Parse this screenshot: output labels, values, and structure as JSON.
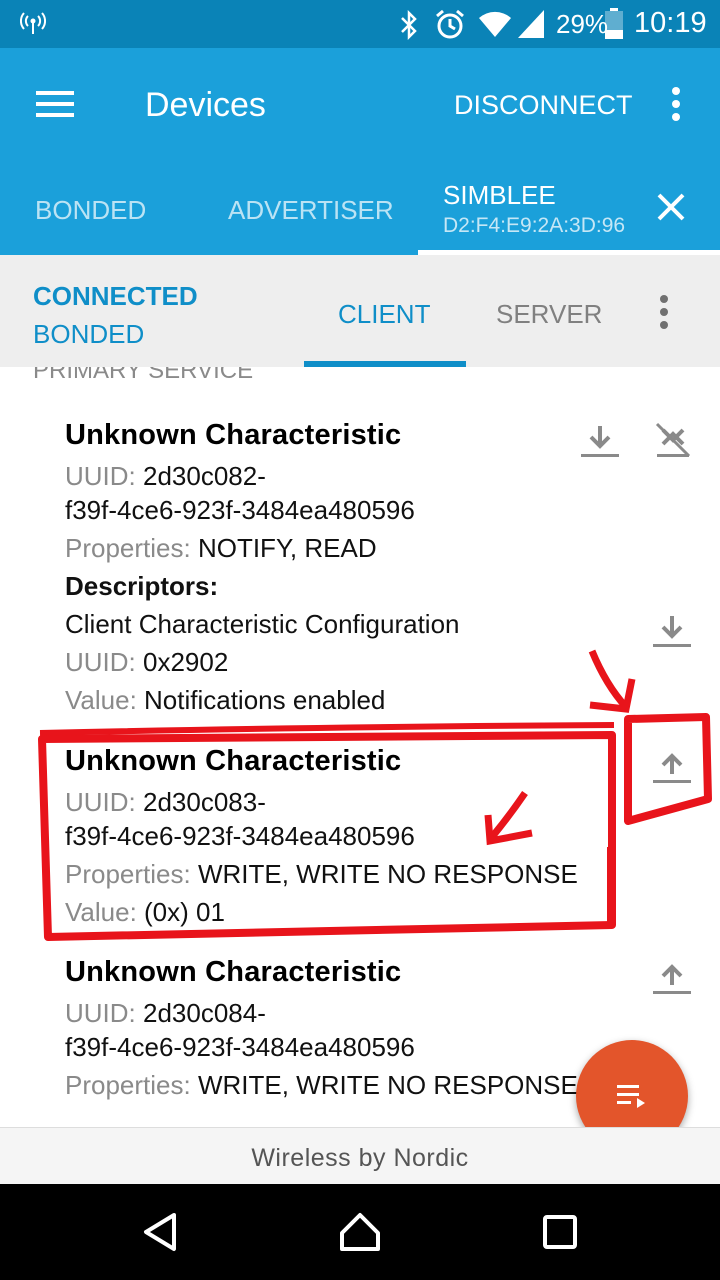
{
  "status_bar": {
    "battery": "29%",
    "time": "10:19"
  },
  "toolbar": {
    "title": "Devices",
    "disconnect_label": "DISCONNECT"
  },
  "device_tabs": [
    {
      "label": "BONDED"
    },
    {
      "label": "ADVERTISER"
    },
    {
      "label": "SIMBLEE",
      "sublabel": "D2:F4:E9:2A:3D:96",
      "selected": true
    }
  ],
  "connection": {
    "state": "CONNECTED",
    "bond": "BONDED"
  },
  "sub_tabs": [
    {
      "label": "CLIENT",
      "selected": true
    },
    {
      "label": "SERVER"
    }
  ],
  "section_header": "PRIMARY SERVICE",
  "labels": {
    "uuid": "UUID: ",
    "properties": "Properties: ",
    "value": "Value: ",
    "descriptors": "Descriptors:"
  },
  "characteristics": [
    {
      "name": "Unknown Characteristic",
      "uuid_line1": "2d30c082-",
      "uuid_line2": "f39f-4ce6-923f-3484ea480596",
      "properties": "NOTIFY, READ",
      "descriptor": {
        "name": "Client Characteristic Configuration",
        "uuid": "0x2902",
        "value": "Notifications enabled"
      }
    },
    {
      "name": "Unknown Characteristic",
      "uuid_line1": "2d30c083-",
      "uuid_line2": "f39f-4ce6-923f-3484ea480596",
      "properties": "WRITE, WRITE NO RESPONSE",
      "value": "(0x) 01"
    },
    {
      "name": "Unknown Characteristic",
      "uuid_line1": "2d30c084-",
      "uuid_line2": "f39f-4ce6-923f-3484ea480596",
      "properties": "WRITE, WRITE NO RESPONSE"
    }
  ],
  "footer": "Wireless by Nordic",
  "colors": {
    "status_bar": "#0a83b7",
    "app_bar": "#1ba0da",
    "accent": "#0f8ec8",
    "fab": "#e3552b",
    "annotation": "#e8141b"
  }
}
